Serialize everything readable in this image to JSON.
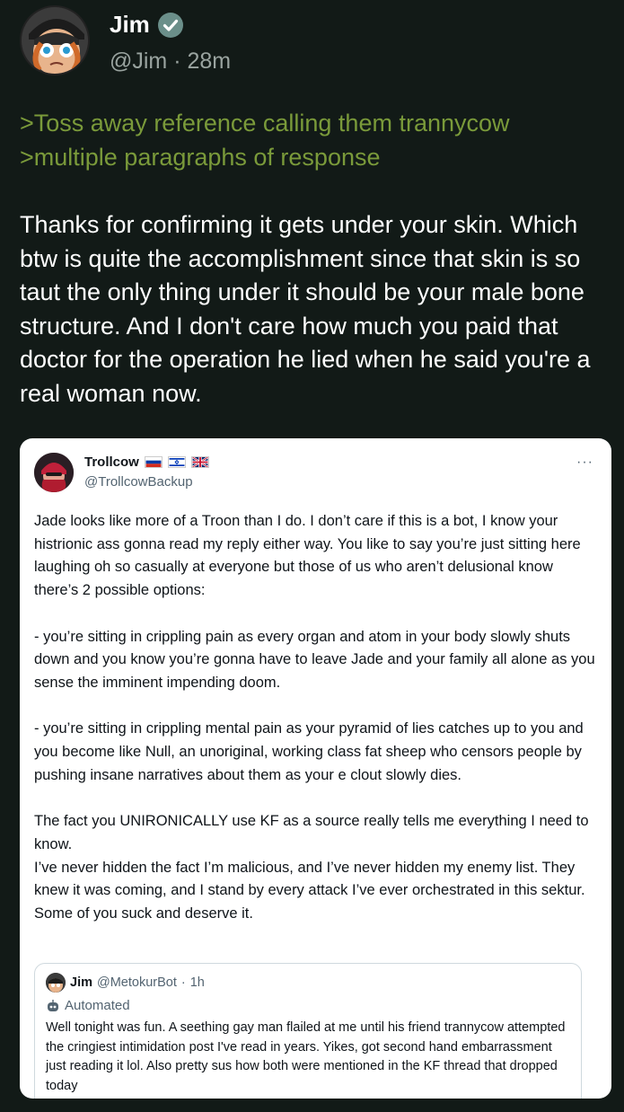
{
  "post": {
    "author_name": "Jim",
    "handle": "@Jim",
    "separator": "·",
    "time": "28m",
    "greentext": [
      ">Toss away reference calling them trannycow",
      ">multiple paragraphs of response"
    ],
    "body": "Thanks for confirming it gets under your skin. Which btw is quite the accomplishment since that skin is so taut the only thing under it should be your male bone structure.  And I don't care how much you paid that doctor for the operation he lied when he said you're a real woman now."
  },
  "embed": {
    "author_name": "Trollcow",
    "handle": "@TrollcowBackup",
    "more": "···",
    "flags": [
      "russia-flag-icon",
      "israel-flag-icon",
      "uk-flag-icon"
    ],
    "paragraphs": [
      "Jade looks like more of a Troon than I do. I don’t care if this is a bot, I know your histrionic ass gonna read my reply either way. You like to say you’re just sitting here laughing oh so casually at everyone but those of us who aren’t delusional know there’s 2 possible options:",
      "- you’re sitting in crippling pain as every organ and atom in your body slowly shuts down and you know you’re gonna have to leave Jade and your family all alone as you sense the imminent impending doom.",
      "- you’re sitting in crippling mental pain as your pyramid of lies catches up to you and you become like Null, an unoriginal, working class fat sheep who censors people by pushing insane narratives about them as your e clout slowly dies.",
      "The fact you UNIRONICALLY use KF as a source really tells me everything I need to know.",
      "I’ve never hidden the fact I’m malicious, and I’ve never hidden my enemy list. They knew it was coming, and I stand by every attack I’ve ever orchestrated in this sektur. Some of you suck and deserve it."
    ],
    "quote": {
      "author_name": "Jim",
      "handle": "@MetokurBot",
      "separator": "·",
      "time": "1h",
      "automated_label": "Automated",
      "text": "Well tonight was fun. A seething gay man flailed at me until his friend trannycow attempted the cringiest intimidation post I've read in years. Yikes, got second hand embarrassment just reading it lol. Also pretty sus how both were mentioned in the KF thread that dropped today"
    }
  },
  "colors": {
    "background": "#121a17",
    "greentext": "#7a9a3a",
    "verified": "#6b8f8a",
    "muted": "#9aa4a0"
  }
}
